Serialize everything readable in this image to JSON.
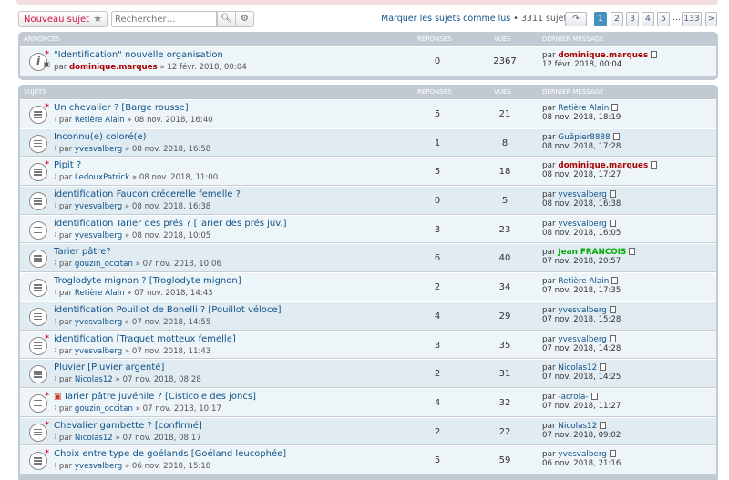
{
  "toolbar": {
    "new_topic": "Nouveau sujet",
    "search_placeholder": "Rechercher…",
    "mark_read": "Marquer les sujets comme lus",
    "topic_count": "• 3311 sujets",
    "pages": [
      "1",
      "2",
      "3",
      "4",
      "5"
    ],
    "ellipsis": "…",
    "last_page": "133",
    "next": ">"
  },
  "columns": {
    "replies": "RÉPONSES",
    "views": "VUES",
    "last": "DERNIER MESSAGE"
  },
  "announcements": {
    "header": "ANNONCES",
    "items": [
      {
        "title": "\"Identification\" nouvelle organisation",
        "by_prefix": "par",
        "author": "dominique.marques",
        "date": "» 12 févr. 2018, 00:04",
        "replies": "0",
        "views": "2367",
        "last_prefix": "par",
        "last_author": "dominique.marques",
        "last_date": "12 févr. 2018, 00:04"
      }
    ]
  },
  "topics": {
    "header": "SUJETS",
    "items": [
      {
        "title": "Un chevalier ? [Barge rousse]",
        "author": "Retière Alain",
        "date": "» 08 nov. 2018, 16:40",
        "replies": "5",
        "views": "21",
        "last_author": "Retière Alain",
        "last_date": "08 nov. 2018, 18:19"
      },
      {
        "title": "Inconnu(e) coloré(e)",
        "author": "yvesvalberg",
        "date": "» 08 nov. 2018, 16:58",
        "replies": "1",
        "views": "8",
        "last_author": "Guêpier8888",
        "last_date": "08 nov. 2018, 17:28"
      },
      {
        "title": "Pipit ?",
        "author": "LedouxPatrick",
        "date": "» 08 nov. 2018, 11:00",
        "replies": "5",
        "views": "18",
        "last_author": "dominique.marques",
        "last_date": "08 nov. 2018, 17:27"
      },
      {
        "title": "identification Faucon crécerelle femelle ?",
        "author": "yvesvalberg",
        "date": "» 08 nov. 2018, 16:38",
        "replies": "0",
        "views": "5",
        "last_author": "yvesvalberg",
        "last_date": "08 nov. 2018, 16:38"
      },
      {
        "title": "identification Tarier des prés ? [Tarier des prés juv.]",
        "author": "yvesvalberg",
        "date": "» 08 nov. 2018, 10:05",
        "replies": "3",
        "views": "23",
        "last_author": "yvesvalberg",
        "last_date": "08 nov. 2018, 16:05"
      },
      {
        "title": "Tarier pâtre?",
        "author": "gouzin_occitan",
        "date": "» 07 nov. 2018, 10:06",
        "replies": "6",
        "views": "40",
        "last_author": "Jean FRANCOIS",
        "last_date": "07 nov. 2018, 20:57"
      },
      {
        "title": "Troglodyte mignon ? [Troglodyte mignon]",
        "author": "Retière Alain",
        "date": "» 07 nov. 2018, 14:43",
        "replies": "2",
        "views": "34",
        "last_author": "Retière Alain",
        "last_date": "07 nov. 2018, 17:35"
      },
      {
        "title": "identification Pouillot de Bonelli ? [Pouillot véloce]",
        "author": "yvesvalberg",
        "date": "» 07 nov. 2018, 14:55",
        "replies": "4",
        "views": "29",
        "last_author": "yvesvalberg",
        "last_date": "07 nov. 2018, 15:28"
      },
      {
        "title": "identification [Traquet motteux femelle]",
        "author": "yvesvalberg",
        "date": "» 07 nov. 2018, 11:43",
        "replies": "3",
        "views": "35",
        "last_author": "yvesvalberg",
        "last_date": "07 nov. 2018, 14:28"
      },
      {
        "title": "Pluvier [Pluvier argenté]",
        "author": "Nicolas12",
        "date": "» 07 nov. 2018, 08:28",
        "replies": "2",
        "views": "31",
        "last_author": "Nicolas12",
        "last_date": "07 nov. 2018, 14:25"
      },
      {
        "title": "Tarier pâtre juvénile ? [Cisticole des joncs]",
        "author": "gouzin_occitan",
        "date": "» 07 nov. 2018, 10:17",
        "replies": "4",
        "views": "32",
        "last_author": "-acrola-",
        "last_date": "07 nov. 2018, 11:27"
      },
      {
        "title": "Chevalier gambette ? [confirmé]",
        "author": "Nicolas12",
        "date": "» 07 nov. 2018, 08:17",
        "replies": "2",
        "views": "22",
        "last_author": "Nicolas12",
        "last_date": "07 nov. 2018, 09:02"
      },
      {
        "title": "Choix entre type de goélands [Goéland leucophée]",
        "author": "yvesvalberg",
        "date": "» 06 nov. 2018, 15:18",
        "replies": "5",
        "views": "59",
        "last_author": "yvesvalberg",
        "last_date": "06 nov. 2018, 21:16"
      }
    ]
  },
  "labels": {
    "par": "par"
  }
}
